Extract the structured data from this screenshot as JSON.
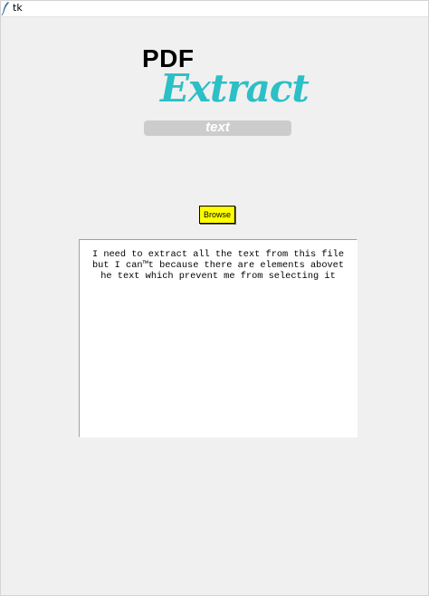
{
  "window": {
    "title": "tk"
  },
  "logo": {
    "line1": "PDF",
    "line2": "Extract",
    "tagline": "text",
    "colors": {
      "extract": "#2bbfc6",
      "bar": "#cccccc"
    }
  },
  "browse": {
    "label": "Browse",
    "color": "#ffff00"
  },
  "output": {
    "text": "I need to extract all the text from this file\nbut I can™t because there are elements abovet\nhe text which prevent me from selecting it"
  }
}
